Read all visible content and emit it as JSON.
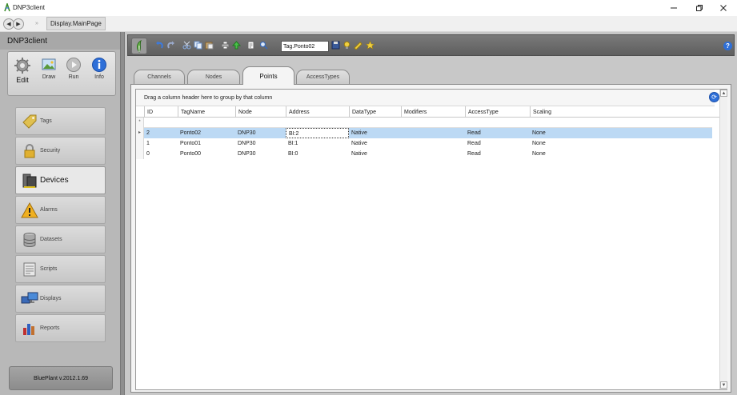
{
  "window": {
    "title": "DNP3client",
    "controls": [
      "minimize",
      "restore",
      "close"
    ]
  },
  "nav": {
    "back_icon": "chevron-left-icon",
    "forward_icon": "chevron-right-icon",
    "separator": "»",
    "page": "Display.MainPage"
  },
  "sidebar": {
    "title": "DNP3client",
    "modes": [
      {
        "label": "Edit",
        "icon": "gear-icon"
      },
      {
        "label": "Draw",
        "icon": "picture-icon"
      },
      {
        "label": "Run",
        "icon": "play-icon"
      },
      {
        "label": "Info",
        "icon": "info-icon"
      }
    ],
    "items": [
      {
        "label": "Tags",
        "icon": "tag-icon"
      },
      {
        "label": "Security",
        "icon": "lock-icon"
      },
      {
        "label": "Devices",
        "icon": "devices-icon",
        "active": true
      },
      {
        "label": "Alarms",
        "icon": "warning-icon"
      },
      {
        "label": "Datasets",
        "icon": "database-icon"
      },
      {
        "label": "Scripts",
        "icon": "script-icon"
      },
      {
        "label": "Displays",
        "icon": "monitor-icon"
      },
      {
        "label": "Reports",
        "icon": "report-icon"
      }
    ],
    "version": "BluePlant  v.2012.1.69"
  },
  "toolbar": {
    "tag_value": "Tag.Ponto02",
    "help_icon": "help-icon"
  },
  "tabs": [
    {
      "label": "Channels"
    },
    {
      "label": "Nodes"
    },
    {
      "label": "Points",
      "active": true
    },
    {
      "label": "AccessTypes"
    }
  ],
  "grid": {
    "group_hint": "Drag a column header here to group by that column",
    "columns": [
      "ID",
      "TagName",
      "Node",
      "Address",
      "DataType",
      "Modifiers",
      "AccessType",
      "Scaling"
    ],
    "new_row_marker": "*",
    "rows": [
      {
        "id": "2",
        "tagname": "Ponto02",
        "node": "DNP30",
        "address": "BI:2",
        "datatype": "Native",
        "modifiers": "",
        "accesstype": "Read",
        "scaling": "None",
        "selected": true
      },
      {
        "id": "1",
        "tagname": "Ponto01",
        "node": "DNP30",
        "address": "BI:1",
        "datatype": "Native",
        "modifiers": "",
        "accesstype": "Read",
        "scaling": "None"
      },
      {
        "id": "0",
        "tagname": "Ponto00",
        "node": "DNP30",
        "address": "BI:0",
        "datatype": "Native",
        "modifiers": "",
        "accesstype": "Read",
        "scaling": "None"
      }
    ]
  },
  "colors": {
    "selection": "#bcd9f4",
    "sidebar_bg": "#b8b8b8",
    "toolbar_bg": "#6a6a6a",
    "accent_blue": "#2e6fd8"
  }
}
